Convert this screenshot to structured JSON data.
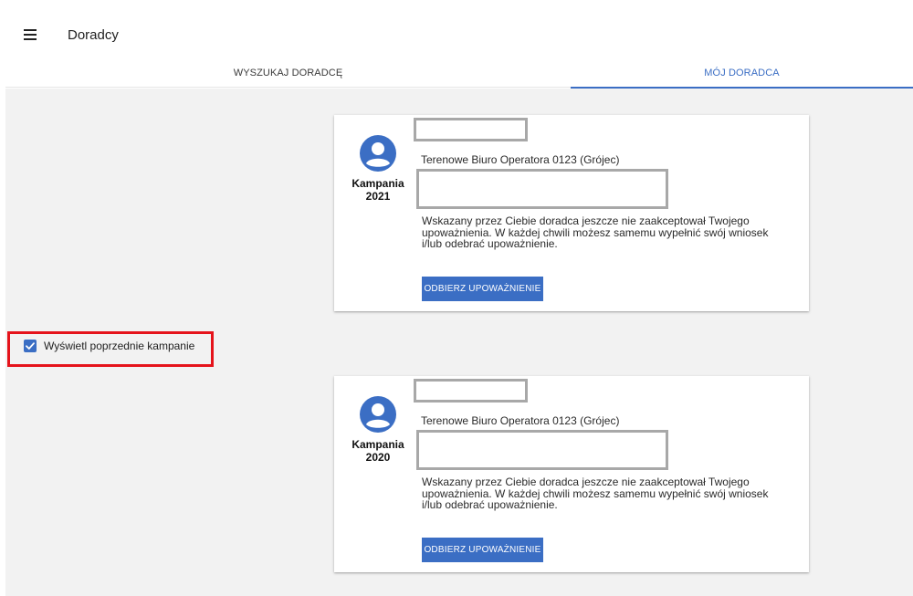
{
  "header": {
    "title": "Doradcy",
    "menu_icon": "menu-icon"
  },
  "tabs": [
    {
      "label": "WYSZUKAJ DORADCĘ",
      "active": false
    },
    {
      "label": "MÓJ DORADCA",
      "active": true
    }
  ],
  "colors": {
    "accent": "#3b6ec4",
    "highlight": "#e5131b",
    "redaction": "#a8a8a8",
    "background": "#f2f2f2"
  },
  "cards": [
    {
      "campaign_label": "Kampania",
      "campaign_year": "2021",
      "office": "Terenowe Biuro Operatora 0123 (Grójec)",
      "message": "Wskazany przez Ciebie doradca jeszcze nie zaakceptował Twojego upoważnienia. W każdej chwili możesz samemu wypełnić swój wniosek i/lub odebrać upoważnienie.",
      "button_label": "ODBIERZ UPOWAŻNIENIE",
      "avatar_icon": "account-circle-icon"
    },
    {
      "campaign_label": "Kampania",
      "campaign_year": "2020",
      "office": "Terenowe Biuro Operatora 0123 (Grójec)",
      "message": "Wskazany przez Ciebie doradca jeszcze nie zaakceptował Twojego upoważnienia. W każdej chwili możesz samemu wypełnić swój wniosek i/lub odebrać upoważnienie.",
      "button_label": "ODBIERZ UPOWAŻNIENIE",
      "avatar_icon": "account-circle-icon"
    }
  ],
  "previous_campaigns": {
    "label": "Wyświetl poprzednie kampanie",
    "checked": true
  }
}
